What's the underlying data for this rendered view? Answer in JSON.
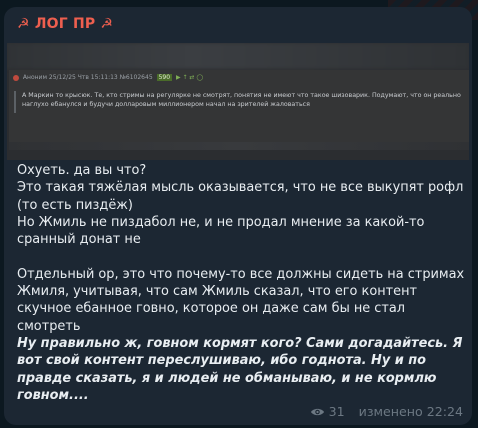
{
  "channel": {
    "title": "☭ ЛОГ ПР ☭"
  },
  "screenshot": {
    "meta_author": "Аноним",
    "meta_date": "25/12/25 Чтв 15:11:13",
    "meta_postnum": "№6102645",
    "meta_badge": "590",
    "meta_extra": "▶ ↑ ⇄ ◯",
    "quote": "А Маркин то крысюк. Те, кто стримы на регулярке не смотрят, понятия не имеют что такое шизоварик. Подумают, что он реально наглухо ебанулся и будучи долларовым миллионером начал на зрителей жаловаться"
  },
  "message": {
    "line1": "Охуеть. да вы что?",
    "line2": "Это такая тяжёлая мысль оказывается, что не все выкупят рофл (то есть пиздёж)",
    "line3": "Но Жмиль не пиздабол не, и не продал мнение за какой-то сранный донат не",
    "line4": "Отдельный ор, это что почему-то все должны сидеть на стримах Жмиля, учитывая, что сам Жмиль сказал, что его контент скучное ебанное говно, которое он даже сам бы не стал смотреть",
    "line5_italic": "Ну правильно ж, говном кормят кого? Сами догадайтесь. Я вот свой контент переслушиваю, ибо годнота. Ну и по правде сказать, я и людей не обманываю, и не кормлю говном...."
  },
  "footer": {
    "views": "31",
    "edited": "изменено 22:24"
  },
  "icons": {
    "views_icon": "eye-icon"
  },
  "colors": {
    "bubble_bg": "#1c2733",
    "sender": "#ee5f4f",
    "text": "#e8edf1",
    "meta": "#6c7883"
  }
}
